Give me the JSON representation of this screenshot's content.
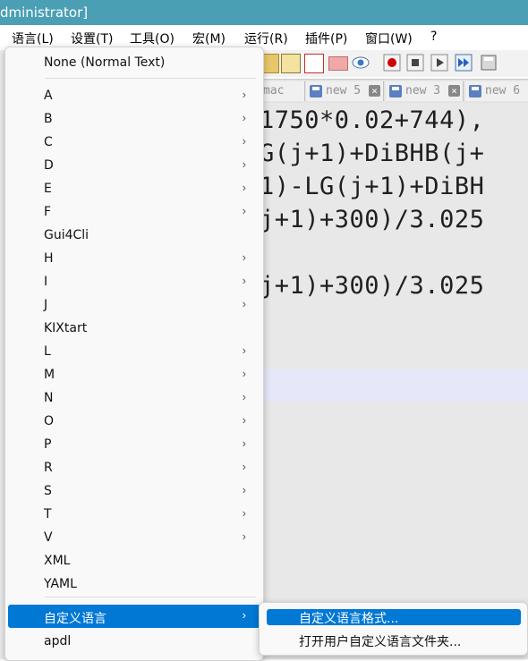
{
  "window": {
    "title": "dministrator]"
  },
  "menubar": {
    "items": [
      "语言(L)",
      "设置(T)",
      "工具(O)",
      "宏(M)",
      "运行(R)",
      "插件(P)",
      "窗口(W)",
      "?"
    ]
  },
  "toolbar": {
    "icons": [
      "paste-icon",
      "find-icon",
      "macro-record-icon",
      "folder-icon",
      "eye-icon",
      "record-icon",
      "stop-icon",
      "play-icon",
      "fast-forward-icon",
      "save-macro-icon"
    ]
  },
  "tabs": [
    {
      "label": "mac"
    },
    {
      "label": "new 5"
    },
    {
      "label": "new 3"
    },
    {
      "label": "new 6"
    }
  ],
  "editor": {
    "lines": [
      "1750*0.02+744),",
      "G(j+1)+DiBHB(j+",
      "1)-LG(j+1)+DiBH",
      "j+1)+300)/3.025",
      "",
      "j+1)+300)/3.025"
    ]
  },
  "language_menu": {
    "items": [
      {
        "label": "None (Normal Text)",
        "submenu": false
      },
      {
        "label": "A",
        "submenu": true
      },
      {
        "label": "B",
        "submenu": true
      },
      {
        "label": "C",
        "submenu": true
      },
      {
        "label": "D",
        "submenu": true
      },
      {
        "label": "E",
        "submenu": true
      },
      {
        "label": "F",
        "submenu": true
      },
      {
        "label": "Gui4Cli",
        "submenu": false
      },
      {
        "label": "H",
        "submenu": true
      },
      {
        "label": "I",
        "submenu": true
      },
      {
        "label": "J",
        "submenu": true
      },
      {
        "label": "KIXtart",
        "submenu": false
      },
      {
        "label": "L",
        "submenu": true
      },
      {
        "label": "M",
        "submenu": true
      },
      {
        "label": "N",
        "submenu": true
      },
      {
        "label": "O",
        "submenu": true
      },
      {
        "label": "P",
        "submenu": true
      },
      {
        "label": "R",
        "submenu": true
      },
      {
        "label": "S",
        "submenu": true
      },
      {
        "label": "T",
        "submenu": true
      },
      {
        "label": "V",
        "submenu": true
      },
      {
        "label": "XML",
        "submenu": false
      },
      {
        "label": "YAML",
        "submenu": false
      },
      {
        "label": "自定义语言",
        "submenu": true
      },
      {
        "label": "apdl",
        "submenu": false
      }
    ],
    "submenu_arrow": "›"
  },
  "user_lang_submenu": {
    "items": [
      "自定义语言格式...",
      "打开用户自定义语言文件夹..."
    ]
  },
  "colors": {
    "accent": "#0078d4",
    "titlebar": "#4a9fb5",
    "keyword": "#2424c8"
  }
}
